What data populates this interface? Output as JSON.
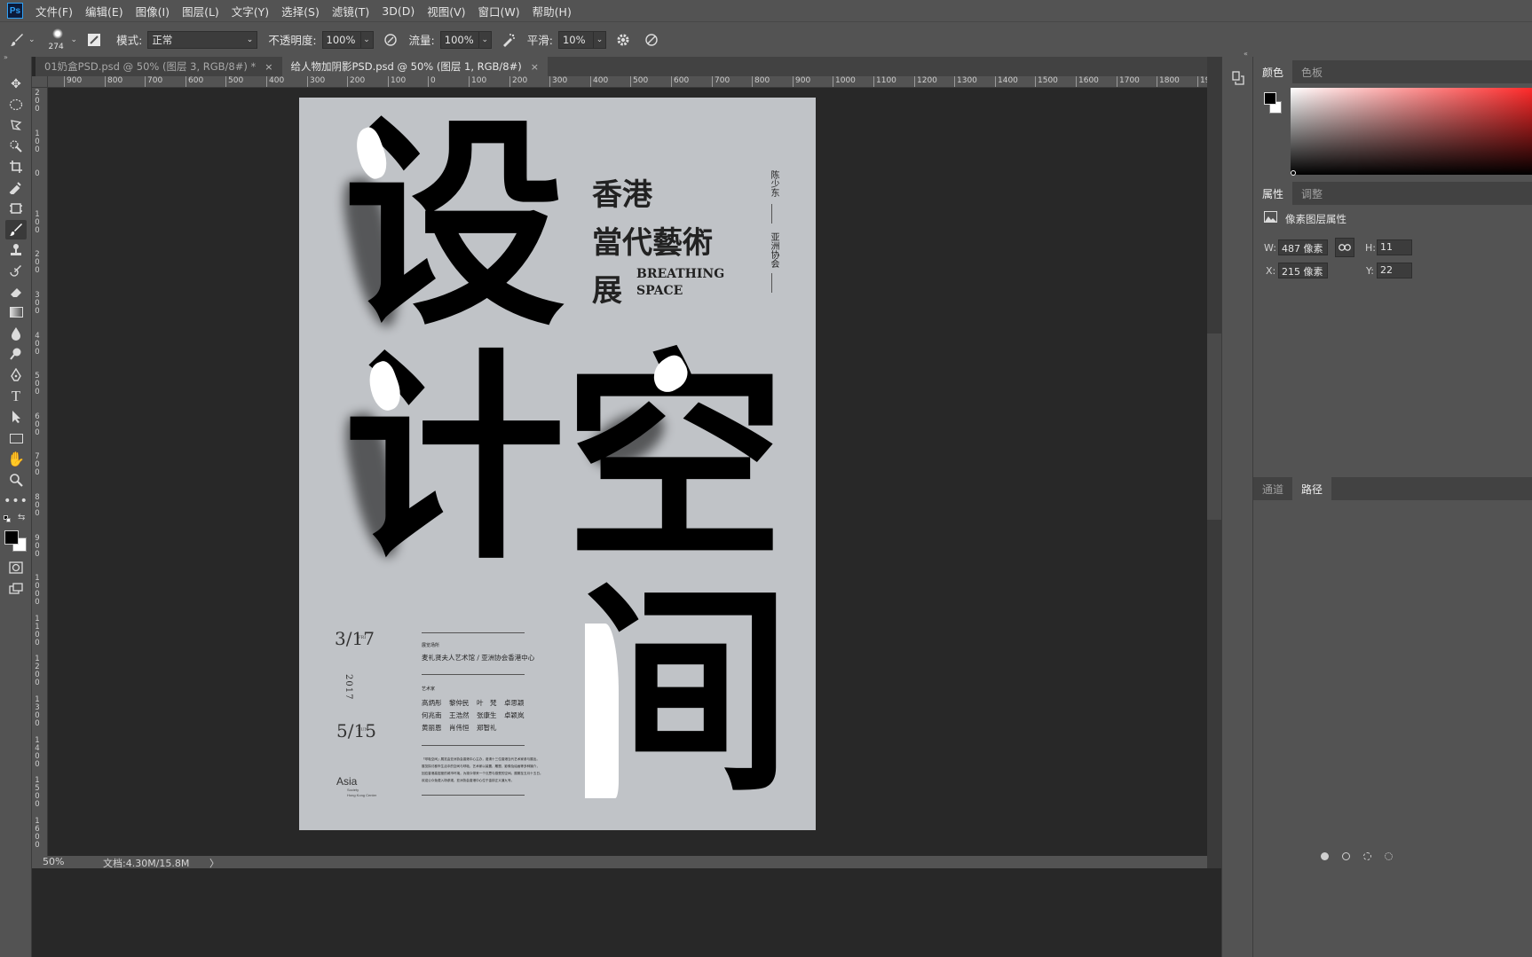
{
  "app": {
    "logo": "Ps"
  },
  "menu": [
    "文件(F)",
    "编辑(E)",
    "图像(I)",
    "图层(L)",
    "文字(Y)",
    "选择(S)",
    "滤镜(T)",
    "3D(D)",
    "视图(V)",
    "窗口(W)",
    "帮助(H)"
  ],
  "options": {
    "brush_size": "274",
    "mode_label": "模式:",
    "mode_value": "正常",
    "opacity_label": "不透明度:",
    "opacity_value": "100%",
    "flow_label": "流量:",
    "flow_value": "100%",
    "smooth_label": "平滑:",
    "smooth_value": "10%"
  },
  "tabs": [
    {
      "label": "01奶盒PSD.psd @ 50% (图层 3, RGB/8#) *",
      "close": "×"
    },
    {
      "label": "给人物加阴影PSD.psd @ 50% (图层 1, RGB/8#)",
      "close": "×"
    }
  ],
  "ruler_top_labels": [
    "900",
    "800",
    "700",
    "600",
    "500",
    "400",
    "300",
    "200",
    "100",
    "0",
    "100",
    "200",
    "300",
    "400",
    "500",
    "600",
    "700",
    "800",
    "900",
    "1000",
    "1100",
    "1200",
    "1300",
    "1400",
    "1500",
    "1600",
    "1700",
    "1800",
    "1900"
  ],
  "ruler_left_labels": [
    "200",
    "100",
    "0",
    "100",
    "200",
    "300",
    "400",
    "500",
    "600",
    "700",
    "800",
    "900",
    "1000",
    "1100",
    "1200",
    "1300",
    "1400",
    "1500",
    "1600"
  ],
  "poster": {
    "char1": "设",
    "char2": "计",
    "char3": "空",
    "char4": "间",
    "title_line1": "香港",
    "title_line2": "當代藝術",
    "title_line3": "展",
    "subtitle_line1": "BREATHING",
    "subtitle_line2": "SPACE",
    "vertical_top": "陈少东",
    "vertical_bottom": "亚洲协会",
    "date_start": "3/17",
    "date_start_small": "FRI",
    "year_vertical": "2017",
    "date_end": "5/15",
    "date_end_small": "SUN",
    "logo_text": "Asia",
    "logo_sub1": "Society",
    "logo_sub2": "Hong Kong Center",
    "venue_small": "展览场所",
    "venue": "麦礼贤夫人艺术馆 / 亚洲协会香港中心",
    "artists_small": "艺术家",
    "artists_row1": [
      "高炳彤",
      "黎仲民",
      "叶　梵",
      "卓思颖"
    ],
    "artists_row2": [
      "何兆南",
      "王浩然",
      "张康生",
      "卓颖岚"
    ],
    "artists_row3": [
      "黄丽恩",
      "肖伟恒",
      "郑智礼"
    ],
    "desc_lines": [
      "「呼吸空间」展览由亚洲协会香港中心主办，邀请十三位香港当代艺术家参与展出。",
      "展览探讨都市生活中的空间与呼吸，艺术家以装置、雕塑、影像及绘画等多种媒介，",
      "回应香港高密度的城市环境，为观众带来一个沉思与感受的空间。展期至五月十五日。",
      "欢迎公众免费入场参观，亚洲协会香港中心位于金钟正义道九号。"
    ]
  },
  "panels": {
    "color_tabs": [
      "颜色",
      "色板"
    ],
    "props_tabs": [
      "属性",
      "调整"
    ],
    "props_title": "像素图层属性",
    "w_label": "W:",
    "w_value": "487 像素",
    "h_label": "H:",
    "h_value": "11",
    "x_label": "X:",
    "x_value": "215 像素",
    "y_label": "Y:",
    "y_value": "22",
    "path_tabs": [
      "通道",
      "路径"
    ]
  },
  "status": {
    "zoom": "50%",
    "doc": "文档:4.30M/15.8M",
    "arrow": "〉"
  }
}
